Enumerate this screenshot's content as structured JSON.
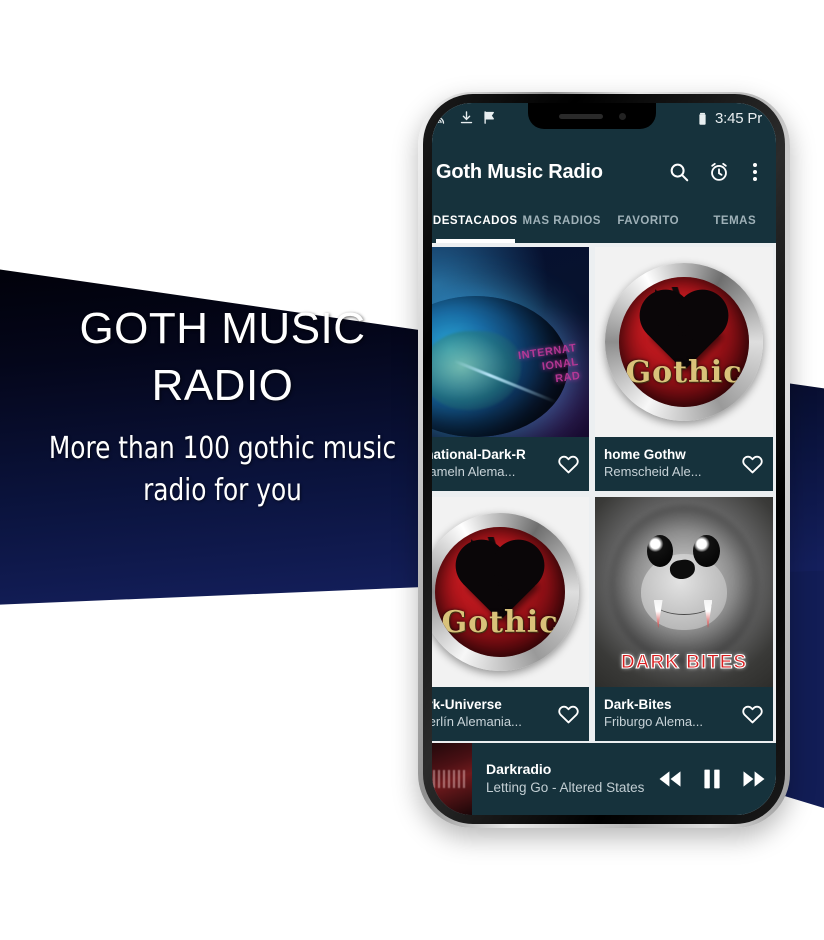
{
  "promo": {
    "title_line1": "GOTH MUSIC",
    "title_line2": "RADIO",
    "subtitle_line1": "More than 100 gothic music",
    "subtitle_line2": "radio for you",
    "background_color": "#0b143f"
  },
  "phone": {
    "statusbar": {
      "icons_left": [
        "cast-icon",
        "download-icon",
        "flag-check-icon"
      ],
      "battery_icon": "battery-icon",
      "time": "3:45 Pr"
    },
    "appbar": {
      "title": "Goth Music Radio",
      "background_color": "#16323c",
      "actions": [
        {
          "name": "search-icon",
          "label": "Search"
        },
        {
          "name": "alarm-icon",
          "label": "Sleep timer"
        },
        {
          "name": "overflow-menu-icon",
          "label": "More options"
        }
      ]
    },
    "tabs": [
      {
        "label": "DESTACADOS",
        "active": true
      },
      {
        "label": "MAS RADIOS",
        "active": false
      },
      {
        "label": "FAVORITO",
        "active": false
      },
      {
        "label": "TEMAS",
        "active": false
      }
    ],
    "stations": [
      {
        "name": "rnational-Dark-R",
        "location": "Hameln Alema...",
        "artwork": "earth",
        "favorite_icon": "heart-outline-icon"
      },
      {
        "name": "home        Gothw",
        "location": "Remscheid Ale...",
        "artwork": "gothic",
        "favorite_icon": "heart-outline-icon"
      },
      {
        "name": "ark-Universe",
        "location": "Berlín Alemania...",
        "artwork": "gothic",
        "favorite_icon": "heart-outline-icon"
      },
      {
        "name": "Dark-Bites",
        "location": "Friburgo Alema...",
        "artwork": "bites",
        "artwork_caption": "DARK  BITES",
        "favorite_icon": "heart-outline-icon"
      }
    ],
    "gothic_logo_word": "Gothic",
    "player": {
      "station": "Darkradio",
      "song": "Letting Go - Altered States",
      "controls": [
        {
          "name": "rewind-button",
          "label": "Rewind"
        },
        {
          "name": "pause-button",
          "label": "Pause"
        },
        {
          "name": "forward-button",
          "label": "Forward"
        }
      ]
    }
  }
}
